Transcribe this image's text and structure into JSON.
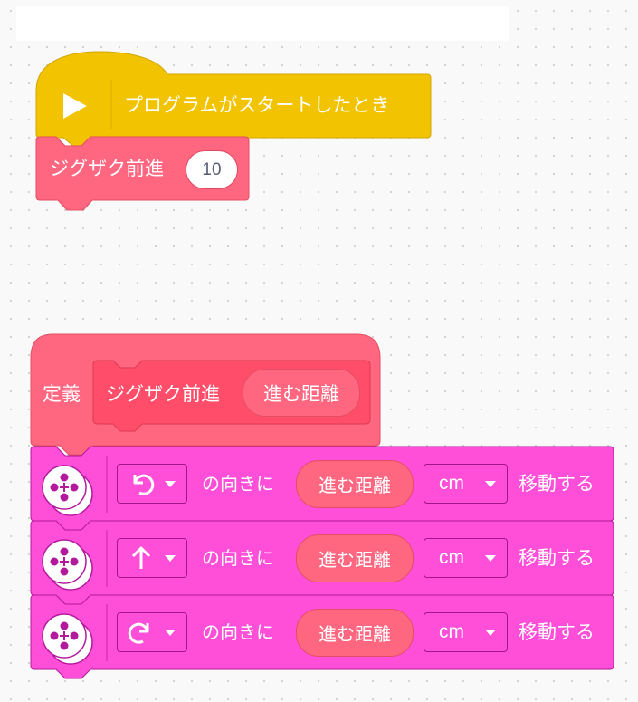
{
  "event_block": {
    "label": "プログラムがスタートしたとき",
    "color": "#f2c300"
  },
  "call_block": {
    "label": "ジグザク前進",
    "value": "10",
    "color": "#ff6680"
  },
  "define_block": {
    "define_label": "定義",
    "name": "ジグザク前進",
    "param": "進む距離",
    "color": "#ff6680",
    "inner_color": "#ff4d6a"
  },
  "move_blocks": [
    {
      "direction_icon": "turn-left-arrow-icon",
      "dir_text": "の向きに",
      "param": "進む距離",
      "unit": "cm",
      "action": "移動する"
    },
    {
      "direction_icon": "up-arrow-icon",
      "dir_text": "の向きに",
      "param": "進む距離",
      "unit": "cm",
      "action": "移動する"
    },
    {
      "direction_icon": "turn-right-arrow-icon",
      "dir_text": "の向きに",
      "param": "進む距離",
      "unit": "cm",
      "action": "移動する"
    }
  ],
  "move_color": "#ff4fd8"
}
